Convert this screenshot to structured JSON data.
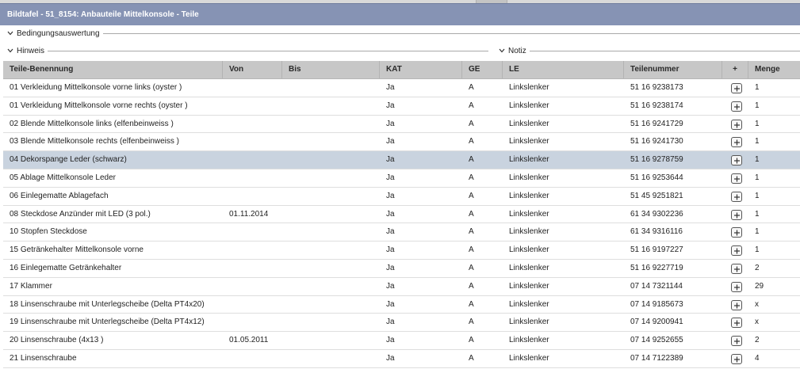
{
  "window": {
    "title": "Bildtafel - 51_8154: Anbauteile Mittelkonsole - Teile"
  },
  "sections": {
    "bedingungsauswertung": "Bedingungsauswertung",
    "hinweis": "Hinweis",
    "notiz": "Notiz"
  },
  "columns": {
    "name": "Teile-Benennung",
    "von": "Von",
    "bis": "Bis",
    "kat": "KAT",
    "ge": "GE",
    "le": "LE",
    "teilenummer": "Teilenummer",
    "plus": "+",
    "menge": "Menge"
  },
  "rows": [
    {
      "name": "01 Verkleidung Mittelkonsole vorne links (oyster )",
      "von": "",
      "bis": "",
      "kat": "Ja",
      "ge": "A",
      "le": "Linkslenker",
      "teilenummer": "51 16 9238173",
      "menge": "1"
    },
    {
      "name": "01 Verkleidung Mittelkonsole vorne rechts (oyster )",
      "von": "",
      "bis": "",
      "kat": "Ja",
      "ge": "A",
      "le": "Linkslenker",
      "teilenummer": "51 16 9238174",
      "menge": "1"
    },
    {
      "name": "02 Blende Mittelkonsole links (elfenbeinweiss )",
      "von": "",
      "bis": "",
      "kat": "Ja",
      "ge": "A",
      "le": "Linkslenker",
      "teilenummer": "51 16 9241729",
      "menge": "1"
    },
    {
      "name": "03 Blende Mittelkonsole rechts (elfenbeinweiss )",
      "von": "",
      "bis": "",
      "kat": "Ja",
      "ge": "A",
      "le": "Linkslenker",
      "teilenummer": "51 16 9241730",
      "menge": "1"
    },
    {
      "name": "04 Dekorspange Leder (schwarz)",
      "von": "",
      "bis": "",
      "kat": "Ja",
      "ge": "A",
      "le": "Linkslenker",
      "teilenummer": "51 16 9278759",
      "menge": "1",
      "selected": true
    },
    {
      "name": "05 Ablage Mittelkonsole Leder",
      "von": "",
      "bis": "",
      "kat": "Ja",
      "ge": "A",
      "le": "Linkslenker",
      "teilenummer": "51 16 9253644",
      "menge": "1"
    },
    {
      "name": "06 Einlegematte Ablagefach",
      "von": "",
      "bis": "",
      "kat": "Ja",
      "ge": "A",
      "le": "Linkslenker",
      "teilenummer": "51 45 9251821",
      "menge": "1"
    },
    {
      "name": "08 Steckdose Anzünder mit LED (3 pol.)",
      "von": "01.11.2014",
      "bis": "",
      "kat": "Ja",
      "ge": "A",
      "le": "Linkslenker",
      "teilenummer": "61 34 9302236",
      "menge": "1"
    },
    {
      "name": "10 Stopfen Steckdose",
      "von": "",
      "bis": "",
      "kat": "Ja",
      "ge": "A",
      "le": "Linkslenker",
      "teilenummer": "61 34 9316116",
      "menge": "1"
    },
    {
      "name": "15 Getränkehalter Mittelkonsole vorne",
      "von": "",
      "bis": "",
      "kat": "Ja",
      "ge": "A",
      "le": "Linkslenker",
      "teilenummer": "51 16 9197227",
      "menge": "1"
    },
    {
      "name": "16 Einlegematte Getränkehalter",
      "von": "",
      "bis": "",
      "kat": "Ja",
      "ge": "A",
      "le": "Linkslenker",
      "teilenummer": "51 16 9227719",
      "menge": "2"
    },
    {
      "name": "17 Klammer",
      "von": "",
      "bis": "",
      "kat": "Ja",
      "ge": "A",
      "le": "Linkslenker",
      "teilenummer": "07 14 7321144",
      "menge": "29"
    },
    {
      "name": "18 Linsenschraube mit Unterlegscheibe (Delta PT4x20)",
      "von": "",
      "bis": "",
      "kat": "Ja",
      "ge": "A",
      "le": "Linkslenker",
      "teilenummer": "07 14 9185673",
      "menge": "x"
    },
    {
      "name": "19 Linsenschraube mit Unterlegscheibe (Delta PT4x12)",
      "von": "",
      "bis": "",
      "kat": "Ja",
      "ge": "A",
      "le": "Linkslenker",
      "teilenummer": "07 14 9200941",
      "menge": "x"
    },
    {
      "name": "20 Linsenschraube (4x13 )",
      "von": "01.05.2011",
      "bis": "",
      "kat": "Ja",
      "ge": "A",
      "le": "Linkslenker",
      "teilenummer": "07 14 9252655",
      "menge": "2"
    },
    {
      "name": "21 Linsenschraube",
      "von": "",
      "bis": "",
      "kat": "Ja",
      "ge": "A",
      "le": "Linkslenker",
      "teilenummer": "07 14 7122389",
      "menge": "4"
    }
  ],
  "colors": {
    "title_bar": "#8693b4",
    "header_bg": "#c7c7c7",
    "selected_row": "#c9d3df"
  }
}
